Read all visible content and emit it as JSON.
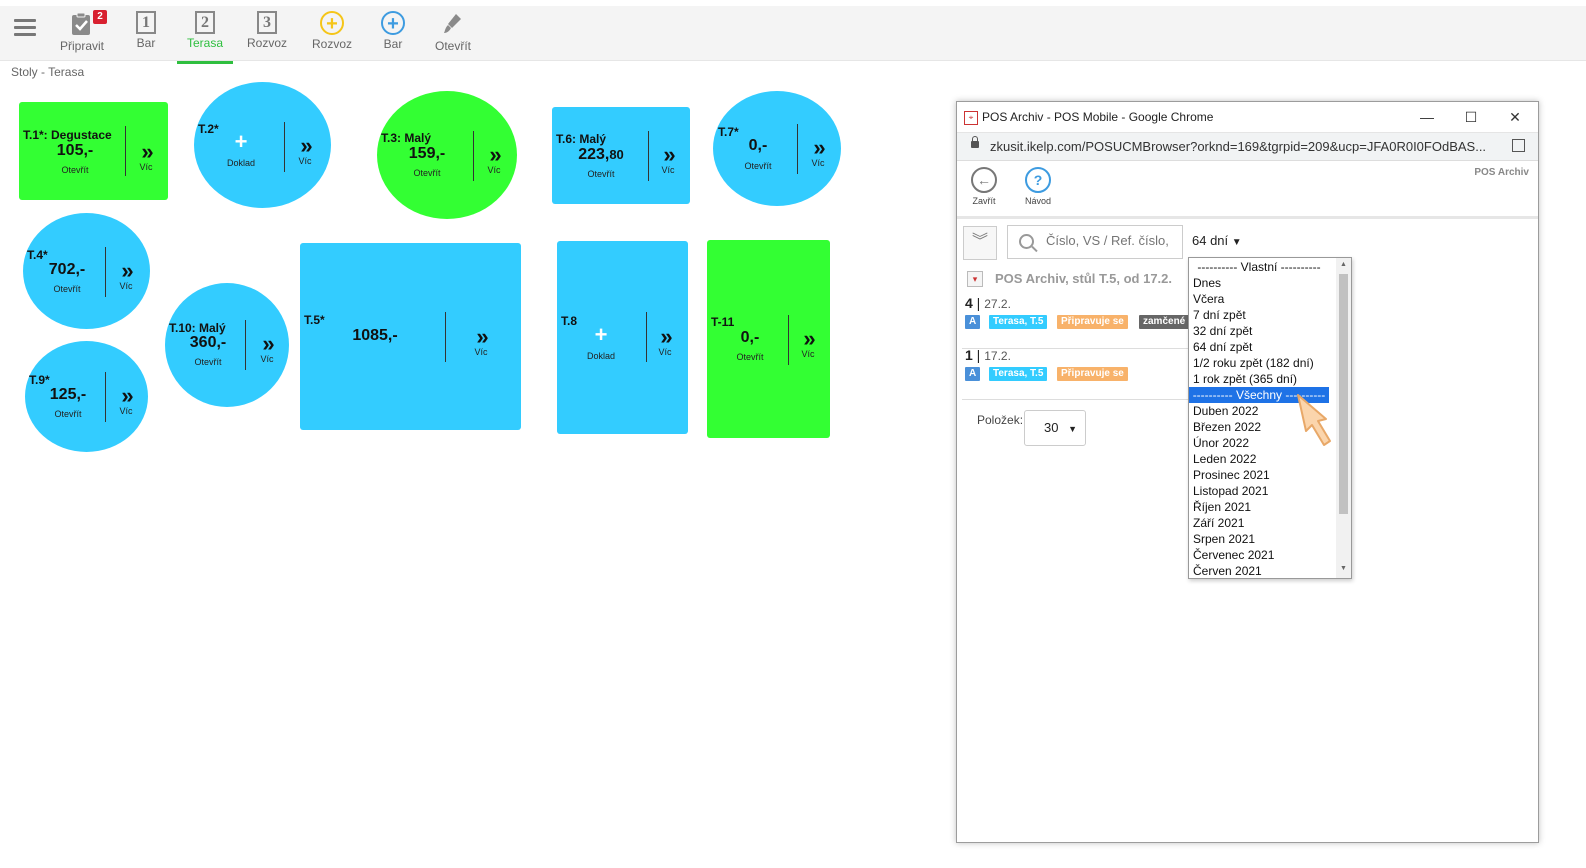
{
  "topnav": {
    "items": [
      {
        "label": "Připravit",
        "badge": "2",
        "icon": "clipboard-check-icon"
      },
      {
        "label": "Bar",
        "number": "1",
        "icon": "number-box-icon"
      },
      {
        "label": "Terasa",
        "number": "2",
        "icon": "number-box-icon",
        "active": true
      },
      {
        "label": "Rozvoz",
        "number": "3",
        "icon": "number-box-icon"
      },
      {
        "label": "Rozvoz",
        "icon": "plus-circle-yellow-icon",
        "color": "#f5c518"
      },
      {
        "label": "Bar",
        "icon": "plus-circle-blue-icon",
        "color": "#3d9be0"
      },
      {
        "label": "Otevřít",
        "icon": "brush-icon"
      }
    ]
  },
  "breadcrumb": "Stoly - Terasa",
  "tables": [
    {
      "name": "T.1*: Degustace",
      "amount": "105,-",
      "sub": "Otevřít",
      "more": "Víc",
      "color": "green"
    },
    {
      "name": "T.2*",
      "sub": "Doklad",
      "more": "Víc",
      "color": "blue"
    },
    {
      "name": "T.3: Malý",
      "amount": "159,-",
      "sub": "Otevřít",
      "more": "Víc",
      "color": "green"
    },
    {
      "name": "T.6: Malý",
      "amount": "223,",
      "amount_dec": "80",
      "sub": "Otevřít",
      "more": "Víc",
      "color": "blue"
    },
    {
      "name": "T.7*",
      "amount": "0,-",
      "sub": "Otevřít",
      "more": "Víc",
      "color": "blue"
    },
    {
      "name": "T.4*",
      "amount": "702,-",
      "sub": "Otevřít",
      "more": "Víc",
      "color": "blue"
    },
    {
      "name": "T.10: Malý",
      "amount": "360,-",
      "sub": "Otevřít",
      "more": "Víc",
      "color": "blue"
    },
    {
      "name": "T.5*",
      "amount": "1085,-",
      "color": "blue"
    },
    {
      "name": "T.8",
      "sub": "Doklad",
      "more": "Víc",
      "color": "blue"
    },
    {
      "name": "T-11",
      "amount": "0,-",
      "sub": "Otevřít",
      "more": "Víc",
      "color": "green"
    },
    {
      "name": "T.9*",
      "amount": "125,-",
      "sub": "Otevřít",
      "more": "Víc",
      "color": "blue"
    }
  ],
  "popup": {
    "window_title": "POS Archiv - POS Mobile - Google Chrome",
    "url": "zkusit.ikelp.com/POSUCMBrowser?orknd=169&tgrpid=209&ucp=JFA0R0I0FOdBAS...",
    "app_title": "POS Archiv",
    "tools": {
      "close_label": "Zavřít",
      "help_label": "Návod"
    },
    "search_placeholder": "Číslo, VS / Ref. číslo,",
    "range_value": "64 dní",
    "list_title": "POS Archiv, stůl T.5, od 17.2.",
    "records": [
      {
        "count": "4",
        "date": "27.2.",
        "tags": [
          {
            "text": "A",
            "color": "#4a90d9"
          },
          {
            "text": "Terasa, T.5",
            "color": "#33ccff"
          },
          {
            "text": "Připravuje se",
            "color": "#f8b26a"
          },
          {
            "text": "zamčené",
            "color": "#666666"
          }
        ]
      },
      {
        "count": "1",
        "date": "17.2.",
        "tags": [
          {
            "text": "A",
            "color": "#4a90d9"
          },
          {
            "text": "Terasa, T.5",
            "color": "#33ccff"
          },
          {
            "text": "Připravuje se",
            "color": "#f8b26a"
          }
        ]
      }
    ],
    "items_label": "Položek:",
    "items_value": "30"
  },
  "range_options": [
    "---------- Vlastní ----------",
    "Dnes",
    "Včera",
    "7 dní zpět",
    "32 dní zpět",
    "64 dní zpět",
    "1/2 roku zpět (182 dní)",
    "1 rok zpět (365 dní)",
    "---------- Všechny ----------",
    "Duben 2022",
    "Březen 2022",
    "Únor 2022",
    "Leden 2022",
    "Prosinec 2021",
    "Listopad 2021",
    "Říjen 2021",
    "Září 2021",
    "Srpen 2021",
    "Červenec 2021",
    "Červen 2021"
  ],
  "range_selected_index": 8,
  "colors": {
    "green": "#33ff33",
    "blue": "#33ccff",
    "active": "#2fbf3f",
    "select": "#1e72e6"
  }
}
